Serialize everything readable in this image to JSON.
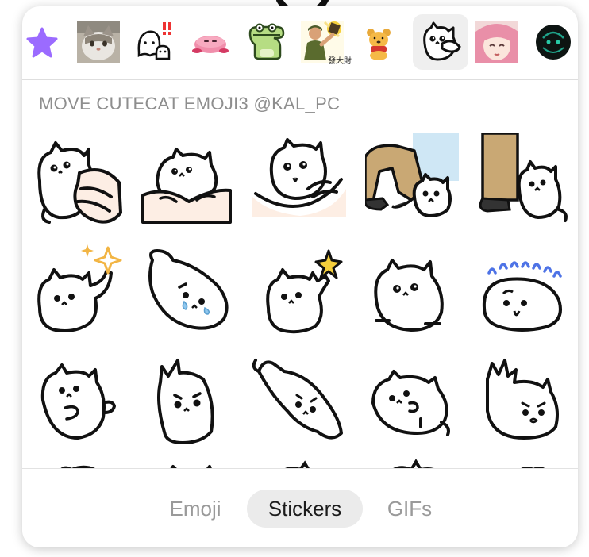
{
  "header": {
    "tabs": [
      {
        "icon": "star-icon",
        "label": ""
      },
      {
        "icon": "cat-photo-pack",
        "label": ""
      },
      {
        "icon": "ghost-cat-pack",
        "label": ""
      },
      {
        "icon": "pink-blob-pack",
        "label": ""
      },
      {
        "icon": "crocodile-pack",
        "label": ""
      },
      {
        "icon": "fortune-man-pack",
        "label": "發大財"
      },
      {
        "icon": "bear-pack",
        "label": ""
      },
      {
        "icon": "cutecat-pack",
        "label": ""
      },
      {
        "icon": "anime-girl-pack",
        "label": ""
      },
      {
        "icon": "dark-pack",
        "label": ""
      }
    ],
    "active_tab": 7
  },
  "pack": {
    "title": "MOVE CUTECAT EMOJI3 @KAL_PC"
  },
  "stickers": [
    "cat-hugging-hand",
    "cat-held-in-hands",
    "cat-on-palm",
    "cat-under-legs",
    "cat-beside-legs",
    "cat-sparkle-wave",
    "cat-crying-lying",
    "cat-star-raise",
    "cat-sitting",
    "cat-anxious-lines",
    "cat-speech",
    "cat-standing-tall",
    "cat-swooping",
    "cat-rolling",
    "cat-angry-burst"
  ],
  "bottom_tabs": {
    "emoji": "Emoji",
    "stickers": "Stickers",
    "gifs": "GIFs",
    "active": "Stickers"
  },
  "colors": {
    "accent_star": "#9b6bff",
    "active_pill": "#ebebeb",
    "inactive_text": "#9a9a9a",
    "section_text": "#8e8e8e"
  }
}
